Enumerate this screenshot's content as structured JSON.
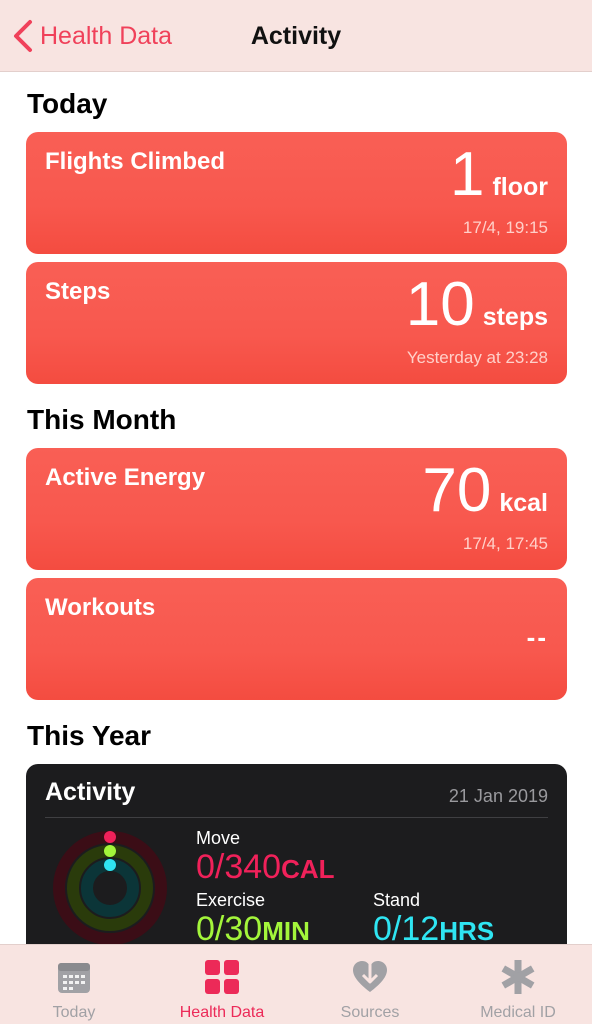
{
  "nav": {
    "back_label": "Health Data",
    "title": "Activity"
  },
  "sections": {
    "today": "Today",
    "this_month": "This Month",
    "this_year": "This Year"
  },
  "cards": [
    {
      "title": "Flights Climbed",
      "value": "1",
      "unit": "floor",
      "time": "17/4, 19:15"
    },
    {
      "title": "Steps",
      "value": "10",
      "unit": "steps",
      "time": "Yesterday at 23:28"
    },
    {
      "title": "Active Energy",
      "value": "70",
      "unit": "kcal",
      "time": "17/4, 17:45"
    },
    {
      "title": "Workouts",
      "value": "--"
    }
  ],
  "activity": {
    "title": "Activity",
    "date": "21 Jan 2019",
    "move": {
      "label": "Move",
      "value": "0/340",
      "unit": "CAL",
      "color": "#f0215a"
    },
    "exercise": {
      "label": "Exercise",
      "value": "0/30",
      "unit": "MIN",
      "color": "#a3f53b"
    },
    "stand": {
      "label": "Stand",
      "value": "0/12",
      "unit": "HRS",
      "color": "#2fe5f2"
    }
  },
  "tabs": [
    {
      "label": "Today",
      "icon": "calendar-icon",
      "active": false
    },
    {
      "label": "Health Data",
      "icon": "grid-icon",
      "active": true
    },
    {
      "label": "Sources",
      "icon": "heart-download-icon",
      "active": false
    },
    {
      "label": "Medical ID",
      "icon": "asterisk-icon",
      "active": false
    }
  ],
  "colors": {
    "accent": "#f0415a",
    "card": "#f95f55",
    "nav_bg": "#f8e4e1"
  }
}
